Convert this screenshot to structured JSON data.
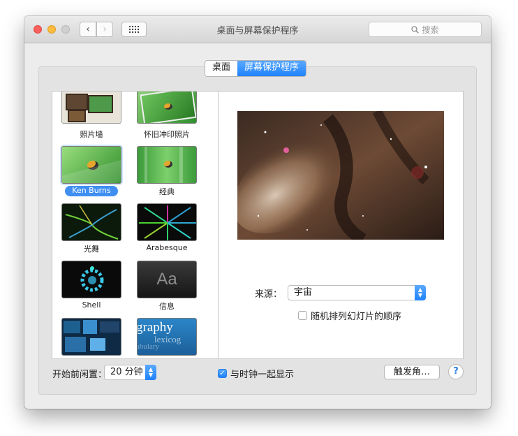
{
  "window": {
    "title": "桌面与屏幕保护程序"
  },
  "toolbar": {
    "back_label": "‹",
    "forward_label": "›",
    "search_placeholder": "搜索"
  },
  "tabs": [
    {
      "label": "桌面"
    },
    {
      "label": "屏幕保护程序"
    }
  ],
  "savers": [
    {
      "label": "照片墙"
    },
    {
      "label": "怀旧冲印照片"
    },
    {
      "label": "Ken Burns"
    },
    {
      "label": "经典"
    },
    {
      "label": "光舞"
    },
    {
      "label": "Arabesque"
    },
    {
      "label": "Shell"
    },
    {
      "label": "信息"
    }
  ],
  "thumb_texts": {
    "messages": "Aa",
    "word1": "graphy",
    "word2": "lexicog",
    "word3": "abulary"
  },
  "options": {
    "source_label": "来源：",
    "source_value": "宇宙",
    "shuffle_label": "随机排列幻灯片的顺序",
    "shuffle_checked": false
  },
  "bottom": {
    "idle_label": "开始前闲置：",
    "idle_value": "20 分钟",
    "clock_label": "与时钟一起显示",
    "clock_checked": true,
    "hot_corners_label": "触发角…",
    "help_label": "?"
  },
  "colors": {
    "accent": "#1f82fa",
    "selection": "#3f8ff3"
  }
}
